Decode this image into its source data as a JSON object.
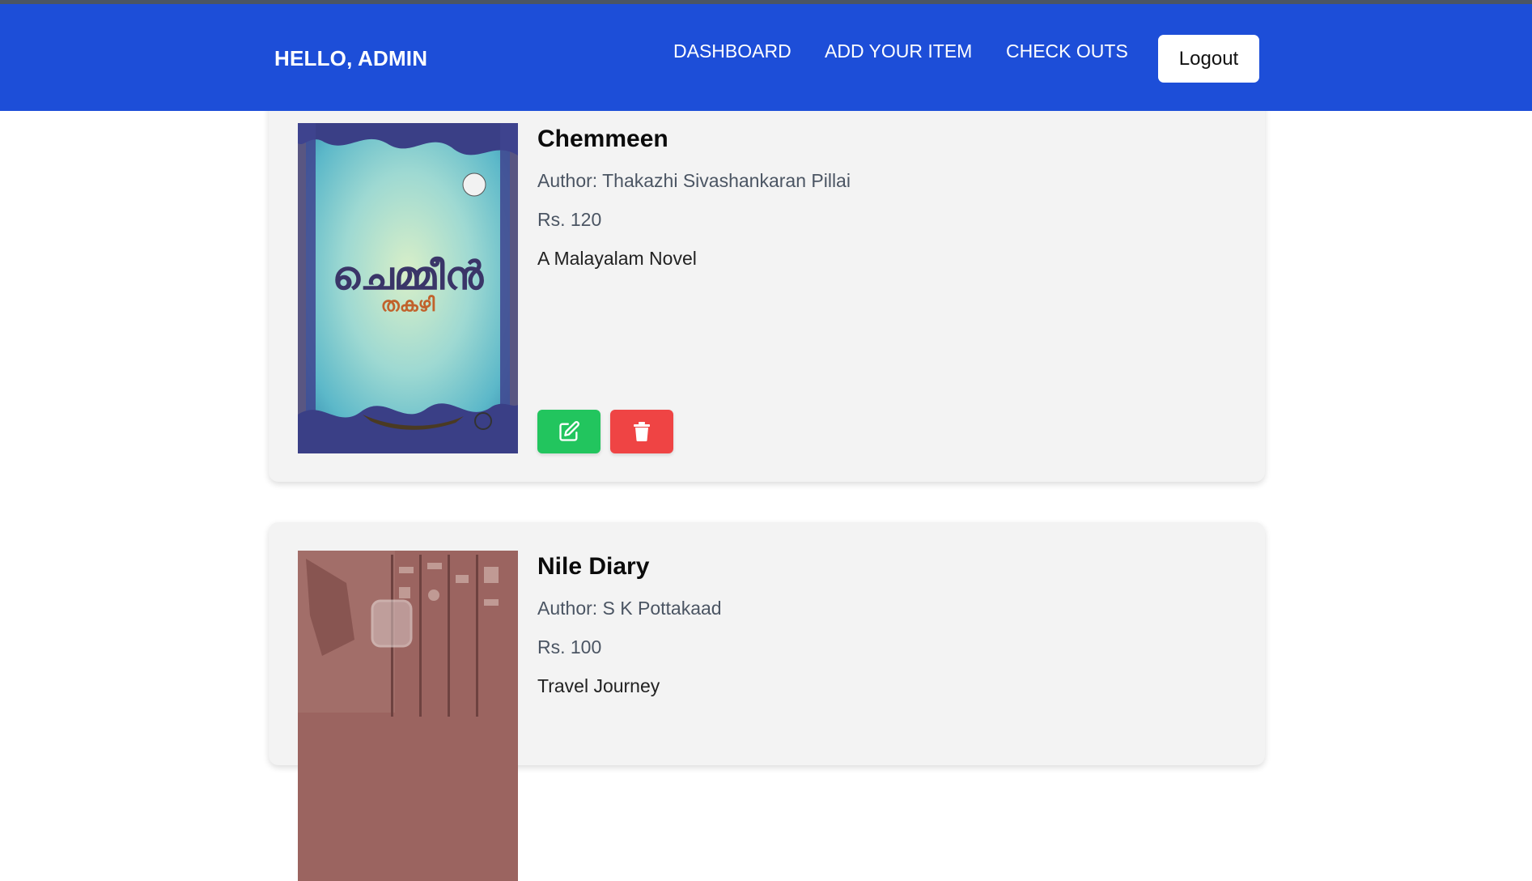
{
  "header": {
    "greeting": "HELLO, ADMIN",
    "nav": [
      "DASHBOARD",
      "ADD YOUR ITEM",
      "CHECK OUTS"
    ],
    "logout": "Logout",
    "color": "#1d4ed8"
  },
  "books": [
    {
      "title": "Chemmeen",
      "author": "Author: Thakazhi Sivashankaran Pillai",
      "price": "Rs. 120",
      "description": "A Malayalam Novel",
      "cover_title": "ചെമ്മീൻ",
      "cover_author": "തകഴി"
    },
    {
      "title": "Nile Diary",
      "author": "Author: S K Pottakaad",
      "price": "Rs. 100",
      "description": "Travel Journey"
    }
  ],
  "actions": {
    "edit_icon": "edit-icon",
    "delete_icon": "trash-icon",
    "edit_color": "#22c55e",
    "delete_color": "#ef4444"
  }
}
